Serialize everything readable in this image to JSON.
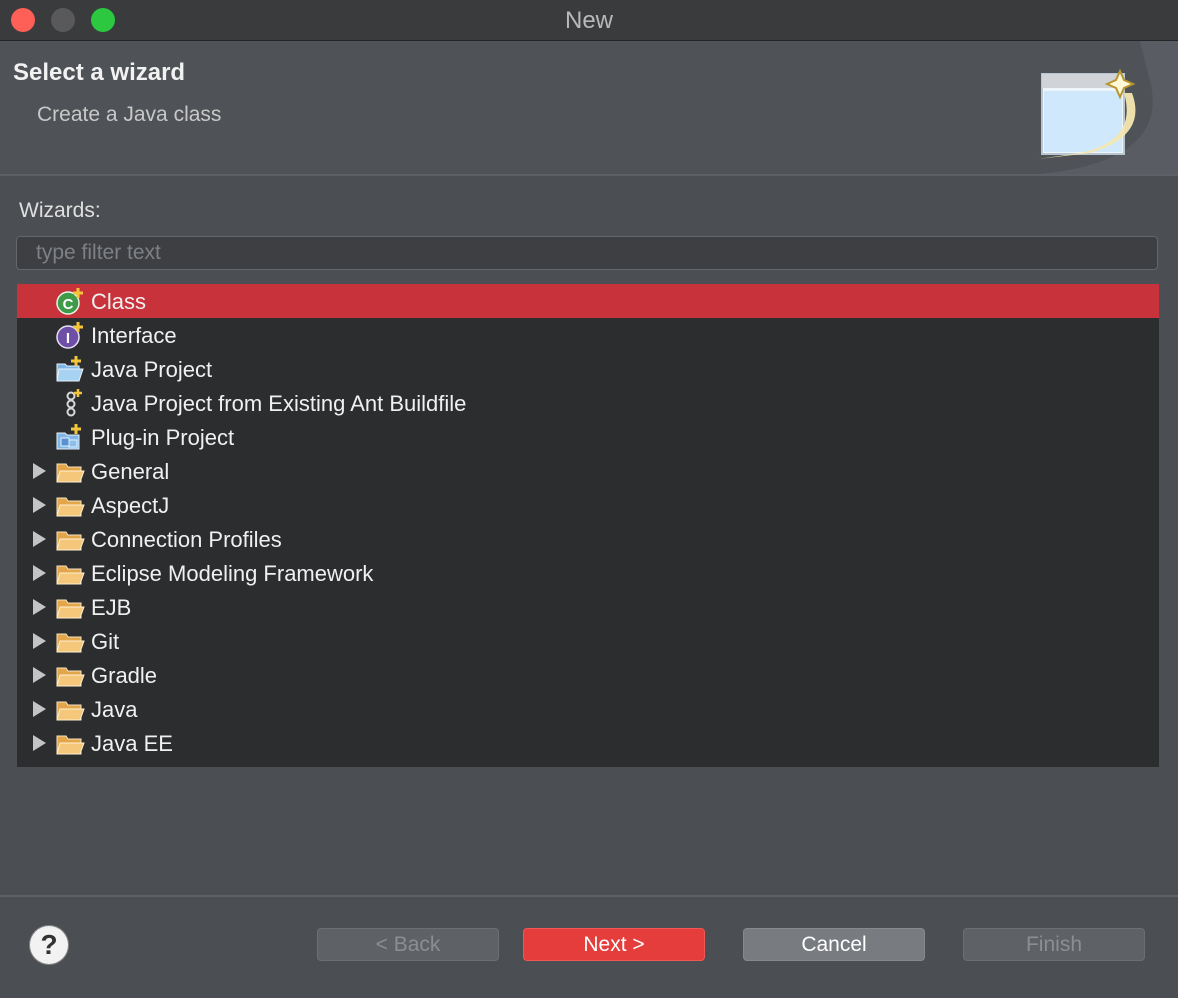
{
  "window": {
    "title": "New"
  },
  "header": {
    "title": "Select a wizard",
    "subtitle": "Create a Java class"
  },
  "wizards": {
    "label": "Wizards:",
    "filter_placeholder": "type filter text",
    "filter_value": "",
    "items": [
      {
        "label": "Class",
        "icon": "java-class-icon",
        "expandable": false,
        "selected": true
      },
      {
        "label": "Interface",
        "icon": "java-interface-icon",
        "expandable": false,
        "selected": false
      },
      {
        "label": "Java Project",
        "icon": "java-project-icon",
        "expandable": false,
        "selected": false
      },
      {
        "label": "Java Project from Existing Ant Buildfile",
        "icon": "ant-buildfile-icon",
        "expandable": false,
        "selected": false
      },
      {
        "label": "Plug-in Project",
        "icon": "plugin-project-icon",
        "expandable": false,
        "selected": false
      },
      {
        "label": "General",
        "icon": "folder-icon",
        "expandable": true,
        "selected": false
      },
      {
        "label": "AspectJ",
        "icon": "folder-icon",
        "expandable": true,
        "selected": false
      },
      {
        "label": "Connection Profiles",
        "icon": "folder-icon",
        "expandable": true,
        "selected": false
      },
      {
        "label": "Eclipse Modeling Framework",
        "icon": "folder-icon",
        "expandable": true,
        "selected": false
      },
      {
        "label": "EJB",
        "icon": "folder-icon",
        "expandable": true,
        "selected": false
      },
      {
        "label": "Git",
        "icon": "folder-icon",
        "expandable": true,
        "selected": false
      },
      {
        "label": "Gradle",
        "icon": "folder-icon",
        "expandable": true,
        "selected": false
      },
      {
        "label": "Java",
        "icon": "folder-icon",
        "expandable": true,
        "selected": false
      },
      {
        "label": "Java EE",
        "icon": "folder-icon",
        "expandable": true,
        "selected": false
      }
    ]
  },
  "buttons": {
    "back": "< Back",
    "next": "Next >",
    "cancel": "Cancel",
    "finish": "Finish"
  },
  "colors": {
    "selection": "#c8323a",
    "primary_button": "#e53c3c",
    "background": "#4b4e52",
    "list_background": "#2c2d2f"
  }
}
